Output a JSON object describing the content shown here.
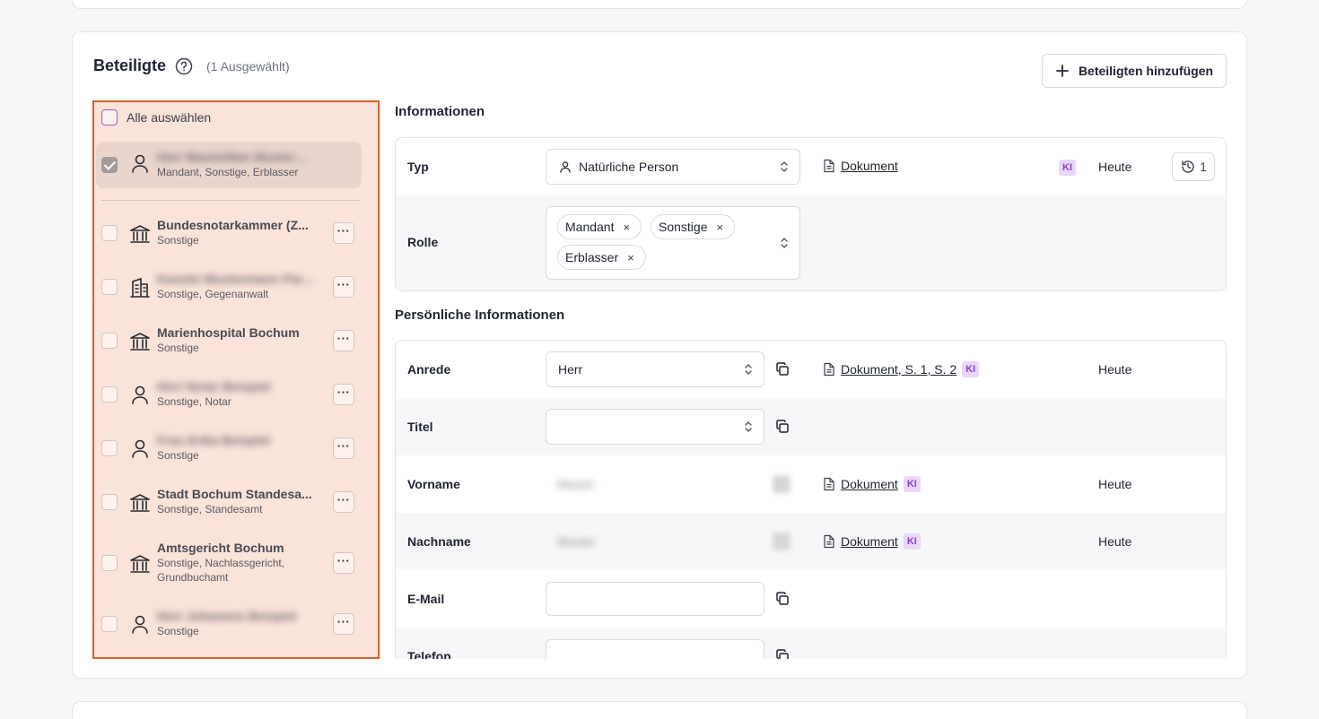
{
  "header": {
    "title": "Beteiligte",
    "selected_count": "(1 Ausgewählt)",
    "add_button": "Beteiligten hinzufügen"
  },
  "list": {
    "select_all": "Alle auswählen",
    "items": [
      {
        "name": "Herr Maximilian Mustermann",
        "roles": "Mandant, Sonstige, Erblasser",
        "icon": "person-icon",
        "blurred": true,
        "selected": true
      },
      {
        "name": "Bundesnotarkammer (Z...",
        "roles": "Sonstige",
        "icon": "institution-icon",
        "blurred": false
      },
      {
        "name": "Kanzlei Mustermann Partner",
        "roles": "Sonstige, Gegenanwalt",
        "icon": "office-building-icon",
        "blurred": true
      },
      {
        "name": "Marienhospital Bochum",
        "roles": "Sonstige",
        "icon": "institution-icon",
        "blurred": false
      },
      {
        "name": "Herr Notar Beispiel",
        "roles": "Sonstige, Notar",
        "icon": "person-icon",
        "blurred": true
      },
      {
        "name": "Frau Erika Beispiel",
        "roles": "Sonstige",
        "icon": "person-icon",
        "blurred": true
      },
      {
        "name": "Stadt Bochum Standesa...",
        "roles": "Sonstige, Standesamt",
        "icon": "institution-icon",
        "blurred": false
      },
      {
        "name": "Amtsgericht Bochum",
        "roles": "Sonstige, Nachlassgericht, Grundbuchamt",
        "icon": "institution-icon",
        "blurred": false
      },
      {
        "name": "Herr Johannes Beispiel",
        "roles": "Sonstige",
        "icon": "person-icon",
        "blurred": true
      }
    ]
  },
  "info": {
    "title": "Informationen",
    "typ_label": "Typ",
    "typ_value": "Natürliche Person",
    "typ_source": "Dokument",
    "ki": "KI",
    "typ_date": "Heute",
    "history_count": "1",
    "rolle_label": "Rolle",
    "rolle_chips": [
      "Mandant",
      "Sonstige",
      "Erblasser"
    ],
    "chip_remove": "×"
  },
  "personal": {
    "title": "Persönliche Informationen",
    "anrede_label": "Anrede",
    "anrede_value": "Herr",
    "anrede_source": "Dokument, S. 1, S. 2",
    "anrede_date": "Heute",
    "titel_label": "Titel",
    "vorname_label": "Vorname",
    "vorname_value": "Maxim",
    "vorname_source": "Dokument",
    "vorname_date": "Heute",
    "nachname_label": "Nachname",
    "nachname_value": "Muster",
    "nachname_source": "Dokument",
    "nachname_date": "Heute",
    "email_label": "E-Mail",
    "telefon_label": "Telefon"
  },
  "colors": {
    "highlight_border": "#d9622b",
    "highlight_bg": "#fae3d9",
    "ki_badge": "#ead7f7"
  }
}
